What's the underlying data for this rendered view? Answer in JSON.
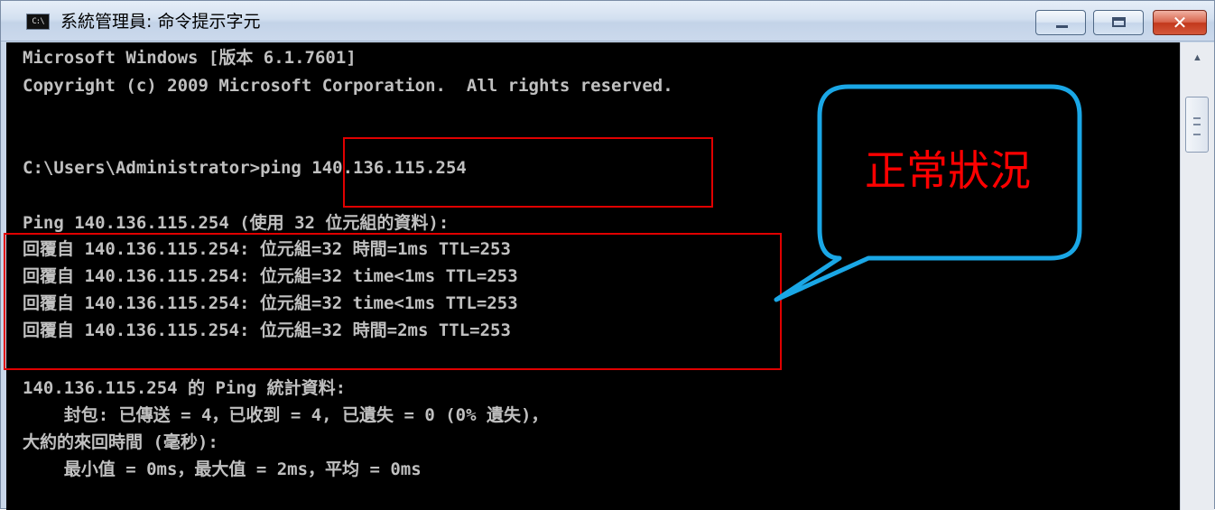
{
  "window": {
    "title": "系統管理員: 命令提示字元",
    "icon_name": "cmd-icon",
    "icon_text": "C:\\"
  },
  "console": {
    "lines": [
      "Microsoft Windows [版本 6.1.7601]",
      "Copyright (c) 2009 Microsoft Corporation.  All rights reserved.",
      "",
      "C:\\Users\\Administrator>ping 140.136.115.254",
      "",
      "Ping 140.136.115.254 (使用 32 位元組的資料):",
      "回覆自 140.136.115.254: 位元組=32 時間=1ms TTL=253",
      "回覆自 140.136.115.254: 位元組=32 time<1ms TTL=253",
      "回覆自 140.136.115.254: 位元組=32 time<1ms TTL=253",
      "回覆自 140.136.115.254: 位元組=32 時間=2ms TTL=253",
      "",
      "140.136.115.254 的 Ping 統計資料:",
      "    封包: 已傳送 = 4，已收到 = 4, 已遺失 = 0 (0% 遺失)，",
      "大約的來回時間 (毫秒):",
      "    最小值 = 0ms，最大值 = 2ms，平均 = 0ms"
    ]
  },
  "annotation": {
    "callout_text": "正常狀況",
    "highlight_color": "#e00000",
    "callout_color": "#1aa7e6",
    "callout_text_color": "#ff0000"
  },
  "colors": {
    "console_bg": "#000000",
    "console_fg": "#c0c0c0"
  }
}
